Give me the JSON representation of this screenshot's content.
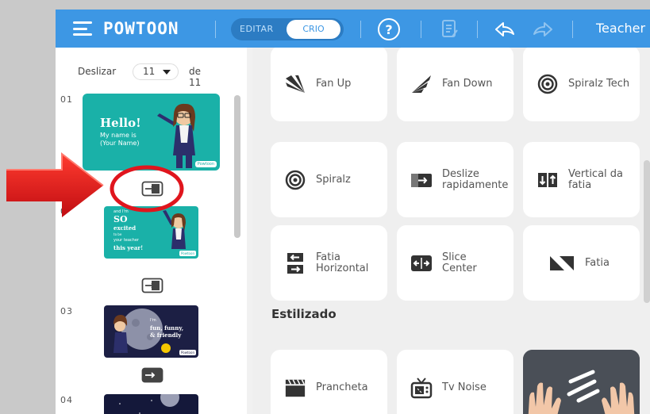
{
  "topbar": {
    "logo": "POWTOON",
    "mode_editar": "EDITAR",
    "mode_crio": "CRIO",
    "help": "?",
    "user": "Teacher"
  },
  "slides_panel": {
    "label_slide": "Deslizar",
    "current_slide": "11",
    "label_of": "de 11",
    "slides": [
      {
        "number": "01",
        "title": "Hello!",
        "line1": "My name is",
        "line2": "(Your Name)",
        "badge": "Powtoon"
      },
      {
        "number": "0",
        "line1": "and I'm",
        "big": "SO",
        "line2": "excited",
        "line3": "to be",
        "line4": "your teacher",
        "line5": "this year!",
        "badge": "Powtoon"
      },
      {
        "number": "03",
        "line1": "I'm",
        "line2": "fun, funny,",
        "line3": "& friendly",
        "badge": "Powtoon"
      },
      {
        "number": "04"
      }
    ]
  },
  "transitions": {
    "row1": [
      "Fan Up",
      "Fan Down",
      "Spiralz Tech"
    ],
    "row2": [
      "Spiralz",
      "Deslize rapidamente",
      "Vertical da fatia"
    ],
    "row3": [
      "Fatia Horizontal",
      "Slice Center",
      "Fatia"
    ],
    "section_stylized": "Estilizado",
    "row4": [
      "Prancheta",
      "Tv Noise"
    ]
  },
  "colors": {
    "topbar": "#3d97e4",
    "thumb_teal": "#1ab1a8",
    "thumb_dark": "#1c1f44",
    "annotation_red": "#e0151d"
  }
}
